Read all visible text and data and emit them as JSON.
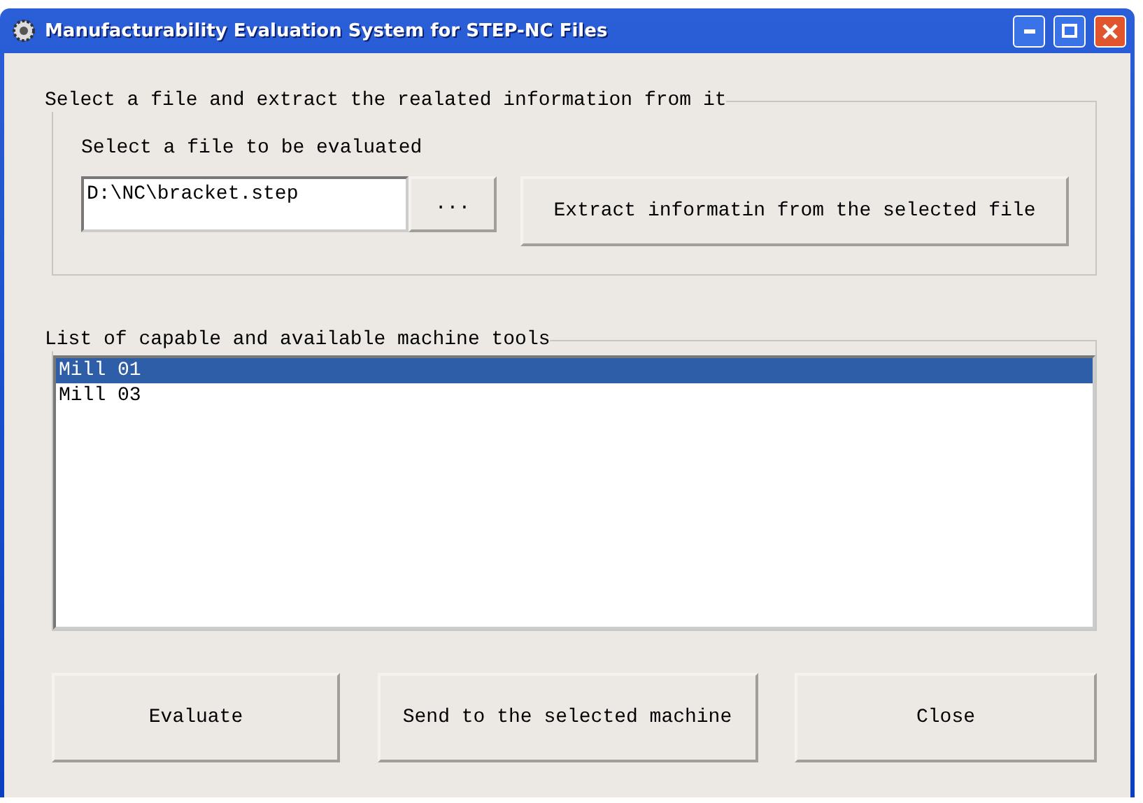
{
  "window": {
    "title": "Manufacturability Evaluation  System for STEP-NC Files"
  },
  "file_group": {
    "legend": "Select a file and extract the realated information from it",
    "label": "Select a file to be evaluated",
    "path": "D:\\NC\\bracket.step",
    "browse_button": "...",
    "extract_button": "Extract informatin from the selected file"
  },
  "machine_group": {
    "legend": "List of capable and available machine tools",
    "items": [
      {
        "name": "Mill 01",
        "selected": true
      },
      {
        "name": "Mill 03",
        "selected": false
      }
    ]
  },
  "buttons": [
    "Evaluate",
    "Send to the selected machine",
    "Close"
  ]
}
